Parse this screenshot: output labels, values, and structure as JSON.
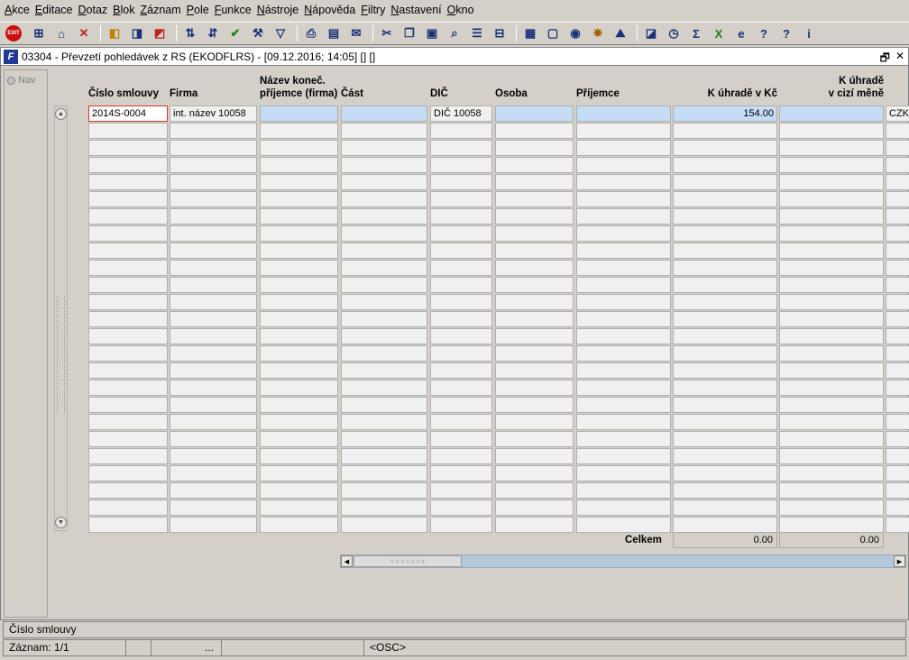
{
  "menu": [
    "Akce",
    "Editace",
    "Dotaz",
    "Blok",
    "Záznam",
    "Pole",
    "Funkce",
    "Nástroje",
    "Nápověda",
    "Filtry",
    "Nastavení",
    "Okno"
  ],
  "toolbar": {
    "exit_label": "EXIT"
  },
  "window": {
    "title": "03304 - Převzetí pohledávek z RS (EKODFLRS) - [09.12.2016; 14:05]  [] []",
    "restore": "🗗",
    "close": "✕"
  },
  "nav": {
    "label": "Nav"
  },
  "headers": {
    "cislo": "Číslo smlouvy",
    "firma": "Firma",
    "nazev1": "Název koneč.",
    "nazev2": "příjemce (firma)",
    "cast": "Část",
    "dic": "DIČ",
    "osoba": "Osoba",
    "prijemce": "Příjemce",
    "kc": "K úhradě v Kč",
    "ciz1": "K úhradě",
    "ciz2": "v cizí měně"
  },
  "rows": [
    {
      "cislo": "2014S-0004",
      "firma": "int. název 10058",
      "nazev": "",
      "cast": "",
      "dic": "DIČ 10058",
      "osoba": "",
      "prijemce": "",
      "kc": "154.00",
      "ciz": "",
      "mena": "CZK"
    }
  ],
  "empty_rows": 24,
  "totals": {
    "label": "Celkem",
    "kc": "0.00",
    "ciz": "0.00"
  },
  "status": {
    "field": "Číslo smlouvy",
    "record": "Záznam: 1/1",
    "dots": "...",
    "mode": "<OSC>"
  }
}
